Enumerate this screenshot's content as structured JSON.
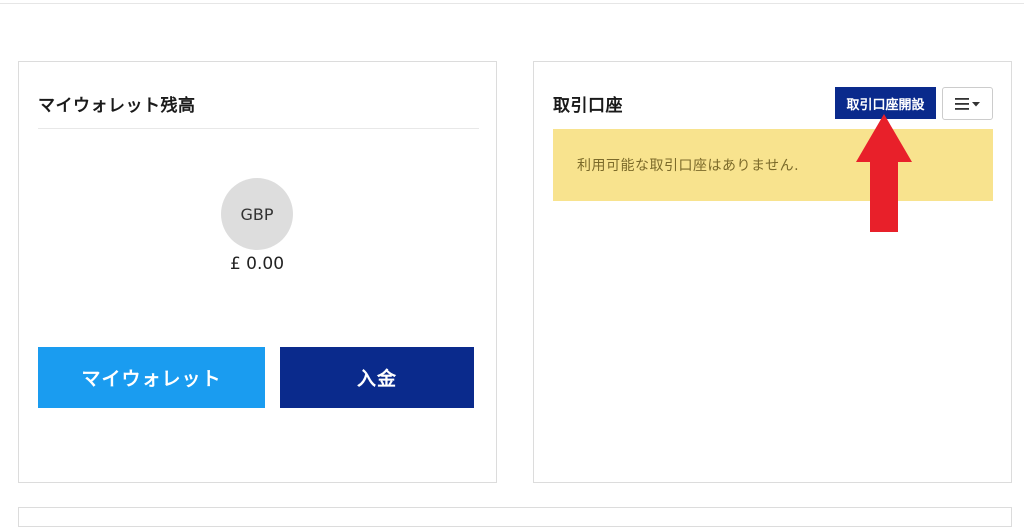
{
  "wallet": {
    "title": "マイウォレット残高",
    "currency": "GBP",
    "balance": "£ 0.00",
    "my_wallet_label": "マイウォレット",
    "deposit_label": "入金"
  },
  "accounts": {
    "title": "取引口座",
    "open_account_label": "取引口座開設",
    "menu_icon": "hamburger-caret-icon",
    "empty_message": "利用可能な取引口座はありません."
  },
  "colors": {
    "primary_dark": "#0a2a8c",
    "primary_light": "#1a9cf0",
    "alert_bg": "#f8e38e",
    "alert_text": "#7b6a2a",
    "annotation_arrow": "#e8202a"
  }
}
